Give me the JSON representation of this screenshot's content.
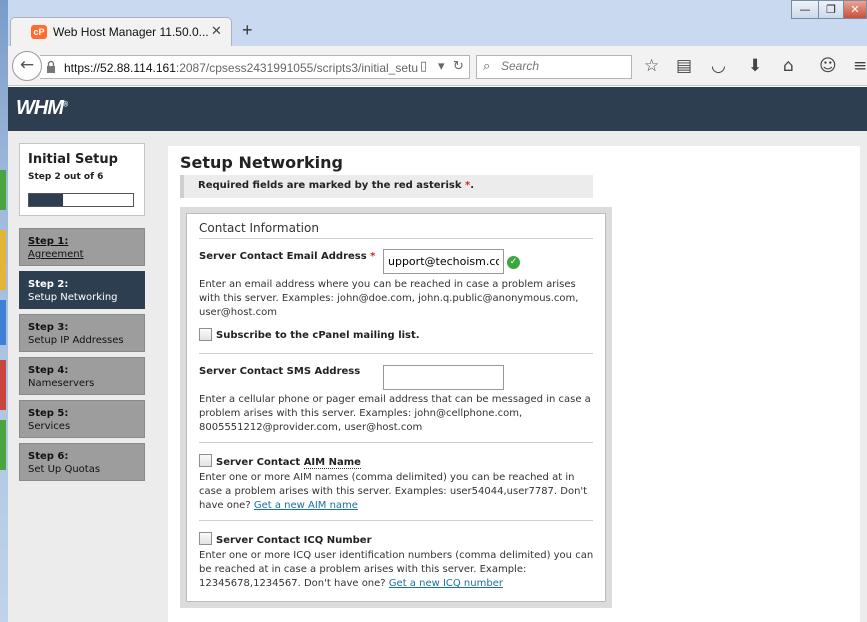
{
  "browser": {
    "tab_title": "Web Host Manager 11.50.0...",
    "tab_favicon_text": "cP",
    "url_host": "https://52.88.114.161",
    "url_rest": ":2087/cpsess2431991055/scripts3/initial_setu",
    "search_placeholder": "Search"
  },
  "whm": {
    "logo": "WHM",
    "trademark": "®"
  },
  "sidebar": {
    "title": "Initial Setup",
    "step_of": "Step 2 out of 6",
    "progress": 0.33,
    "steps": [
      {
        "num": "Step 1:",
        "label": "Agreement"
      },
      {
        "num": "Step 2:",
        "label": "Setup Networking"
      },
      {
        "num": "Step 3:",
        "label": "Setup IP Addresses"
      },
      {
        "num": "Step 4:",
        "label": "Nameservers"
      },
      {
        "num": "Step 5:",
        "label": "Services"
      },
      {
        "num": "Step 6:",
        "label": "Set Up Quotas"
      }
    ]
  },
  "main": {
    "title": "Setup Networking",
    "required_note": "Required fields are marked by the red asterisk",
    "asterisk": "*",
    "period": ".",
    "section_title": "Contact Information",
    "email": {
      "label": "Server Contact Email Address",
      "value": "upport@techoism.com",
      "desc": "Enter an email address where you can be reached in case a problem arises with this server. Examples: john@doe.com, john.q.public@anonymous.com, user@host.com"
    },
    "mailing_list_label": "Subscribe to the cPanel mailing list.",
    "sms": {
      "label": "Server Contact SMS Address",
      "value": "",
      "desc": "Enter a cellular phone or pager email address that can be messaged in case a problem arises with this server. Examples: john@cellphone.com, 8005551212@provider.com, user@host.com"
    },
    "aim": {
      "label_prefix": "Server Contact",
      "label_abbr": "AIM Name",
      "desc": "Enter one or more AIM names (comma delimited) you can be reached at in case a problem arises with this server. Examples: user54044,user7787. Don't have one?",
      "link": "Get a new AIM name"
    },
    "icq": {
      "label": "Server Contact ICQ Number",
      "desc": "Enter one or more ICQ user identification numbers (comma delimited) you can be reached at in case a problem arises with this server. Example: 12345678,1234567. Don't have one?",
      "link": "Get a new ICQ number"
    }
  },
  "colors": {
    "header": "#2d3e50",
    "accent_red": "#d9261c",
    "link": "#1a6fa8",
    "ok": "#3aa83a"
  }
}
